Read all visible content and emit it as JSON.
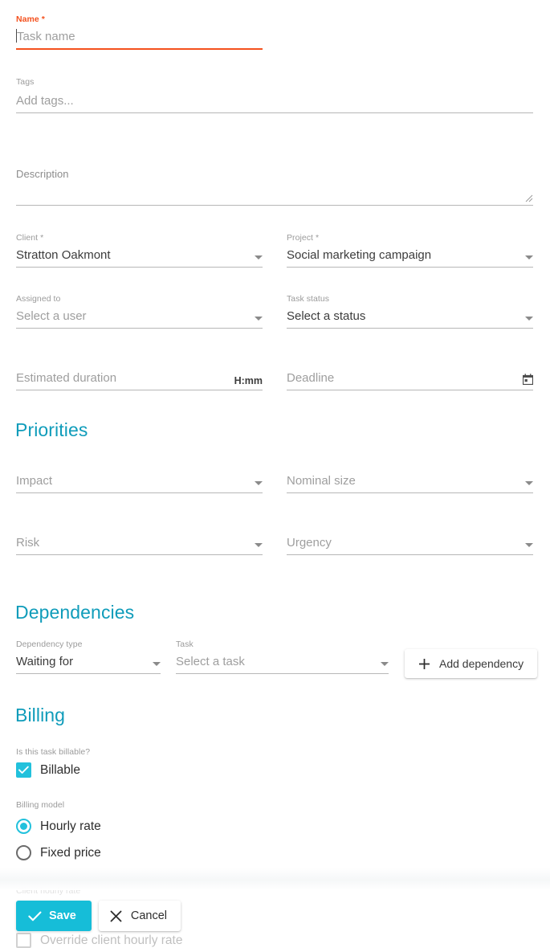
{
  "colors": {
    "accent": "#22c1dc",
    "heading": "#0f9cba",
    "error": "#f4511e",
    "save_button": "#16bdd8",
    "underline": "#b7b7b7"
  },
  "form": {
    "name": {
      "label": "Name *",
      "placeholder": "Task name",
      "value": ""
    },
    "tags": {
      "label": "Tags",
      "placeholder": "Add tags...",
      "value": ""
    },
    "description": {
      "label": "Description",
      "placeholder": "",
      "value": ""
    },
    "client": {
      "label": "Client *",
      "value": "Stratton Oakmont",
      "icon": "chevron-down-icon"
    },
    "project": {
      "label": "Project *",
      "value": "Social marketing campaign",
      "icon": "chevron-down-icon"
    },
    "assigned_to": {
      "label": "Assigned to",
      "placeholder": "Select a user",
      "value": "",
      "icon": "chevron-down-icon"
    },
    "task_status": {
      "label": "Task status",
      "value": "Select a status",
      "icon": "chevron-down-icon"
    },
    "estimated_duration": {
      "placeholder": "Estimated duration",
      "value": "",
      "suffix": "H:mm"
    },
    "deadline": {
      "placeholder": "Deadline",
      "value": "",
      "icon": "calendar-icon"
    }
  },
  "priorities": {
    "title": "Priorities",
    "impact": {
      "placeholder": "Impact",
      "value": "",
      "icon": "chevron-down-icon"
    },
    "nominal_size": {
      "placeholder": "Nominal size",
      "value": "",
      "icon": "chevron-down-icon"
    },
    "risk": {
      "placeholder": "Risk",
      "value": "",
      "icon": "chevron-down-icon"
    },
    "urgency": {
      "placeholder": "Urgency",
      "value": "",
      "icon": "chevron-down-icon"
    }
  },
  "dependencies": {
    "title": "Dependencies",
    "dependency_type": {
      "label": "Dependency type",
      "value": "Waiting for",
      "icon": "chevron-down-icon"
    },
    "task": {
      "label": "Task",
      "placeholder": "Select a task",
      "value": "",
      "icon": "chevron-down-icon"
    },
    "add_button": {
      "label": "Add dependency",
      "icon": "plus-icon"
    }
  },
  "billing": {
    "title": "Billing",
    "billable_question_label": "Is this task billable?",
    "billable_checkbox": {
      "label": "Billable",
      "checked": true,
      "icon": "check-icon"
    },
    "billing_model_label": "Billing model",
    "options": [
      {
        "label": "Hourly rate",
        "selected": true
      },
      {
        "label": "Fixed price",
        "selected": false
      }
    ],
    "client_hourly_rate_label": "Client hourly rate",
    "override_checkbox": {
      "label": "Override client hourly rate",
      "checked": false
    }
  },
  "actions": {
    "save": {
      "label": "Save",
      "icon": "check-icon"
    },
    "cancel": {
      "label": "Cancel",
      "icon": "close-icon"
    }
  }
}
